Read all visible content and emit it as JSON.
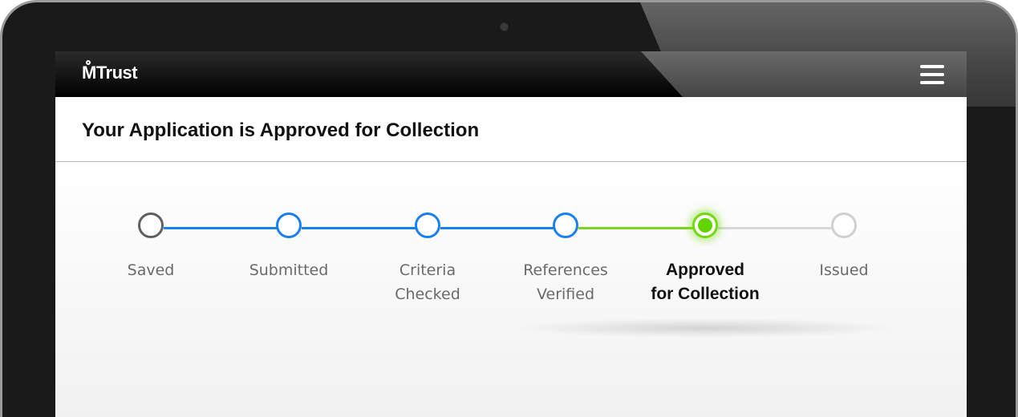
{
  "app": {
    "brand": "MTrust"
  },
  "header": {
    "title": "Your Application is Approved for Collection"
  },
  "icons": {
    "menu": "hamburger-menu-icon",
    "logo": "mtrust-logo"
  },
  "colors": {
    "completed": "#1a7ff0",
    "current": "#62d400",
    "pending": "#d0d0d0",
    "saved": "#606060"
  },
  "progress": {
    "current_step": 5,
    "total_steps": 6,
    "steps": [
      {
        "line1": "Saved",
        "line2": "",
        "status": "saved"
      },
      {
        "line1": "Submitted",
        "line2": "",
        "status": "completed"
      },
      {
        "line1": "Criteria",
        "line2": "Checked",
        "status": "completed"
      },
      {
        "line1": "References",
        "line2": "Verified",
        "status": "completed"
      },
      {
        "line1": "Approved",
        "line2": "for Collection",
        "status": "current"
      },
      {
        "line1": "Issued",
        "line2": "",
        "status": "pending"
      }
    ]
  }
}
